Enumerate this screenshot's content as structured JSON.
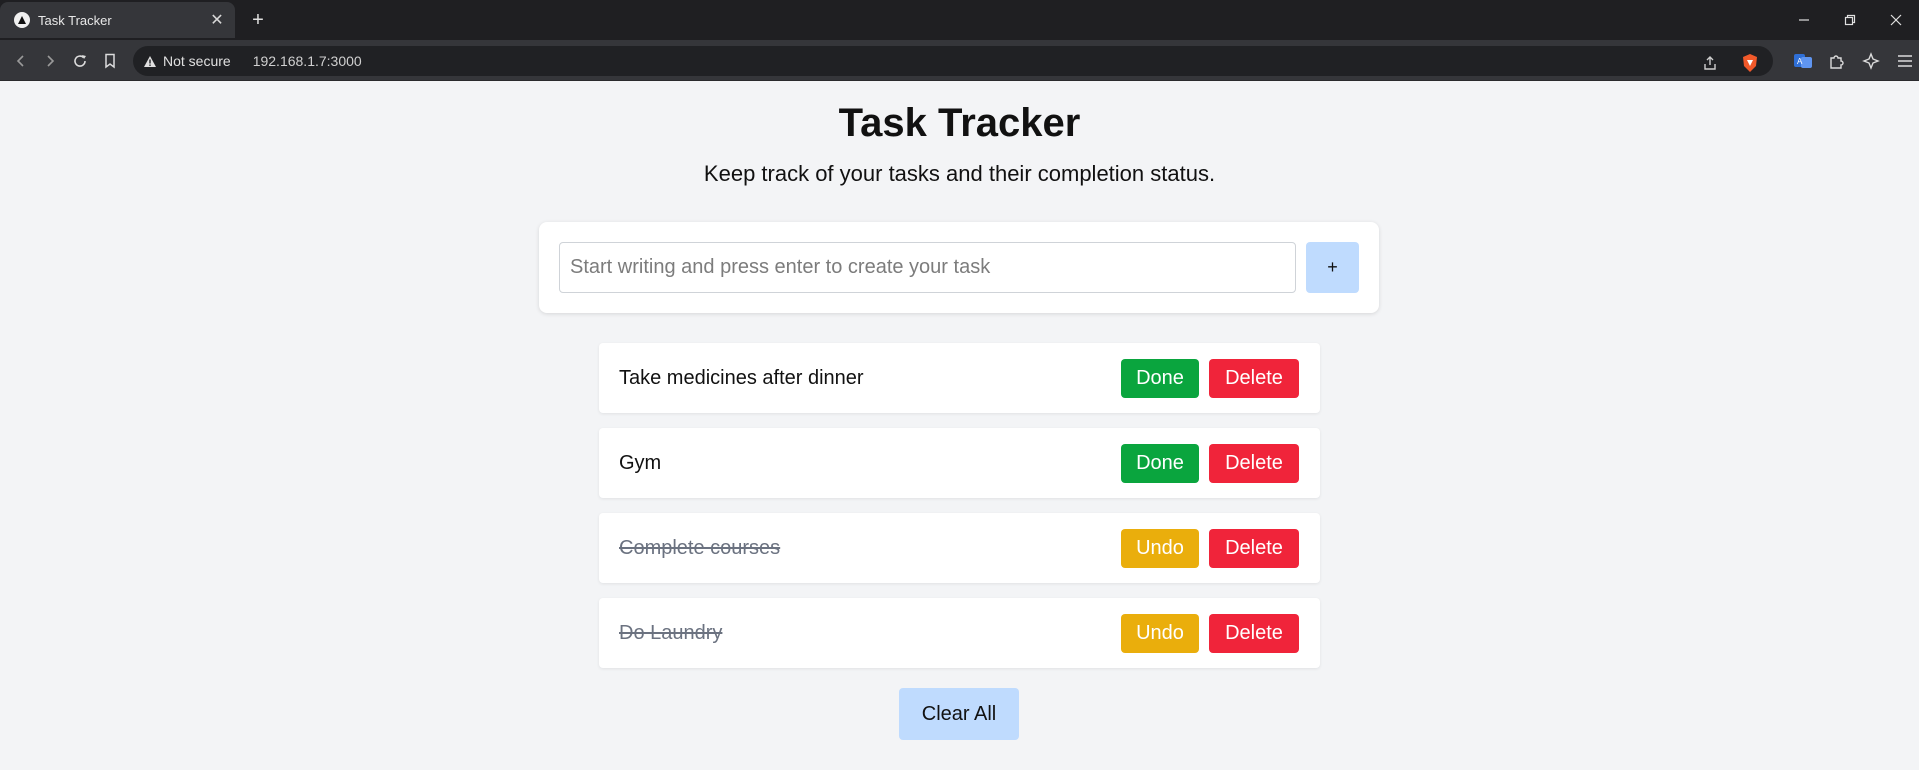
{
  "browser": {
    "tab": {
      "title": "Task Tracker",
      "close_glyph": "✕",
      "favicon": "nextjs-triangle-icon"
    },
    "new_tab_glyph": "+",
    "security_label": "Not secure",
    "url": "192.168.1.7:3000",
    "window_controls": [
      "minimize",
      "restore",
      "close"
    ]
  },
  "page": {
    "title": "Task Tracker",
    "subtitle": "Keep track of your tasks and their completion status."
  },
  "add_task": {
    "placeholder": "Start writing and press enter to create your task",
    "value": "",
    "button_label": "+"
  },
  "tasks": [
    {
      "text": "Take medicines after dinner",
      "completed": false,
      "toggle_label": "Done",
      "delete_label": "Delete"
    },
    {
      "text": "Gym",
      "completed": false,
      "toggle_label": "Done",
      "delete_label": "Delete"
    },
    {
      "text": "Complete courses",
      "completed": true,
      "toggle_label": "Undo",
      "delete_label": "Delete"
    },
    {
      "text": "Do Laundry",
      "completed": true,
      "toggle_label": "Undo",
      "delete_label": "Delete"
    }
  ],
  "clear_all_label": "Clear All",
  "colors": {
    "done": "#0aa53e",
    "undo": "#eaae0c",
    "delete": "#f0243a",
    "primary_light": "#bfdbfe",
    "background": "#f3f4f6"
  }
}
